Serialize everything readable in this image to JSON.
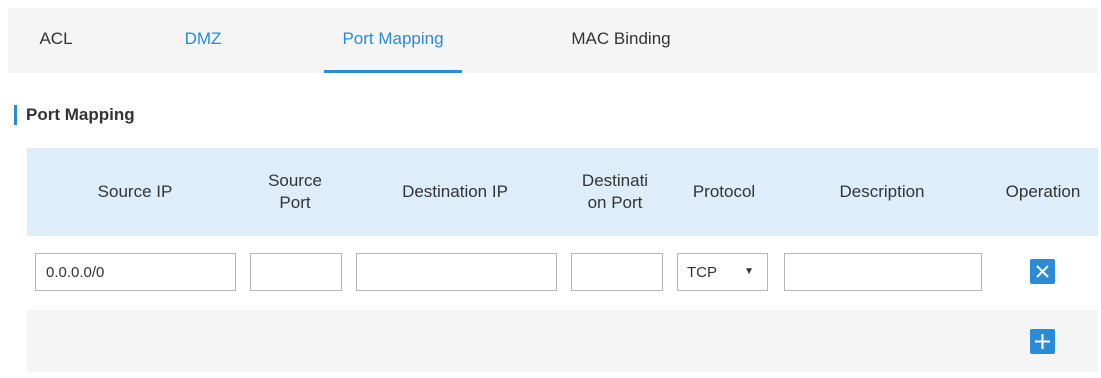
{
  "tabs": [
    {
      "label": "ACL",
      "state": "normal"
    },
    {
      "label": "DMZ",
      "state": "link"
    },
    {
      "label": "Port Mapping",
      "state": "active"
    },
    {
      "label": "MAC Binding",
      "state": "normal"
    }
  ],
  "section_title": "Port Mapping",
  "table": {
    "headers": {
      "source_ip": "Source IP",
      "source_port_1": "Source",
      "source_port_2": "Port",
      "destination_ip": "Destination IP",
      "destination_port_1": "Destinati",
      "destination_port_2": "on Port",
      "protocol": "Protocol",
      "description": "Description",
      "operation": "Operation"
    },
    "rows": [
      {
        "source_ip": "0.0.0.0/0",
        "source_port": "",
        "destination_ip": "",
        "destination_port": "",
        "protocol": "TCP",
        "description": ""
      }
    ]
  },
  "icons": {
    "delete": "close-icon",
    "add": "plus-icon"
  },
  "colors": {
    "accent": "#2b8bd6",
    "header_bg": "#ddedf9",
    "tab_bar_bg": "#f5f5f5"
  }
}
